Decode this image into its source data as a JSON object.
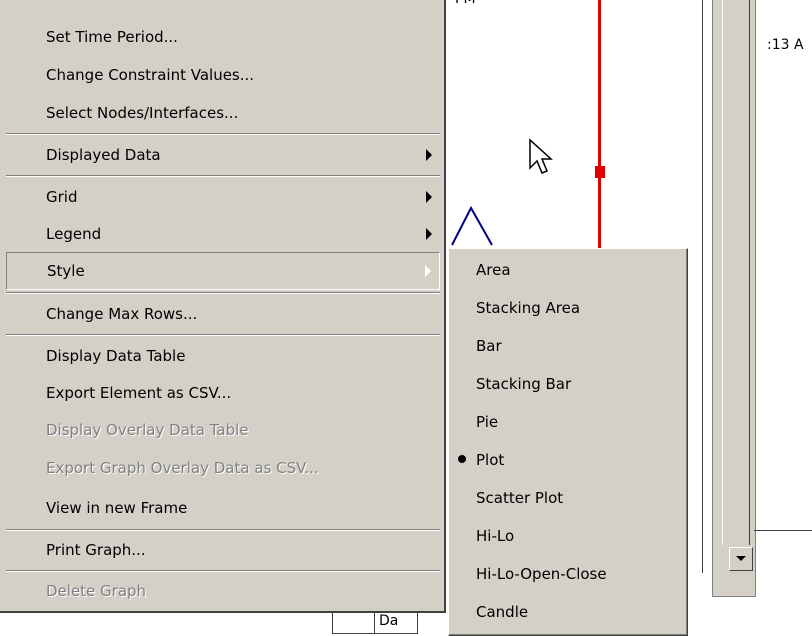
{
  "background": {
    "top_label": "PM",
    "time_fragment": ":13 A",
    "tab_fragment_1": "",
    "tab_fragment_2": "Da"
  },
  "menu": {
    "items": [
      {
        "label": "Set Time Period...",
        "disabled": false
      },
      {
        "label": "Change Constraint Values...",
        "disabled": false
      },
      {
        "label": "Select Nodes/Interfaces...",
        "disabled": false
      },
      {
        "label": "Displayed Data",
        "disabled": false,
        "submenu": true
      },
      {
        "label": "Grid",
        "disabled": false,
        "submenu": true
      },
      {
        "label": "Legend",
        "disabled": false,
        "submenu": true
      },
      {
        "label": "Style",
        "disabled": false,
        "submenu": true,
        "active": true
      },
      {
        "label": "Change Max Rows...",
        "disabled": false
      },
      {
        "label": "Display Data Table",
        "disabled": false
      },
      {
        "label": "Export Element as CSV...",
        "disabled": false
      },
      {
        "label": "Display Overlay Data Table",
        "disabled": true
      },
      {
        "label": "Export Graph Overlay Data as CSV...",
        "disabled": true
      },
      {
        "label": "View in new Frame",
        "disabled": false
      },
      {
        "label": "Print Graph...",
        "disabled": false
      },
      {
        "label": "Delete Graph",
        "disabled": true
      }
    ]
  },
  "style_submenu": {
    "items": [
      {
        "label": "Area",
        "selected": false
      },
      {
        "label": "Stacking Area",
        "selected": false
      },
      {
        "label": "Bar",
        "selected": false
      },
      {
        "label": "Stacking Bar",
        "selected": false
      },
      {
        "label": "Pie",
        "selected": false
      },
      {
        "label": "Plot",
        "selected": true
      },
      {
        "label": "Scatter Plot",
        "selected": false
      },
      {
        "label": "Hi-Lo",
        "selected": false
      },
      {
        "label": "Hi-Lo-Open-Close",
        "selected": false
      },
      {
        "label": "Candle",
        "selected": false
      }
    ]
  },
  "colors": {
    "menu_bg": "#d4d0c8",
    "cursor_line": "#e00000",
    "plot_line": "#000080",
    "disabled_text": "#808080"
  }
}
